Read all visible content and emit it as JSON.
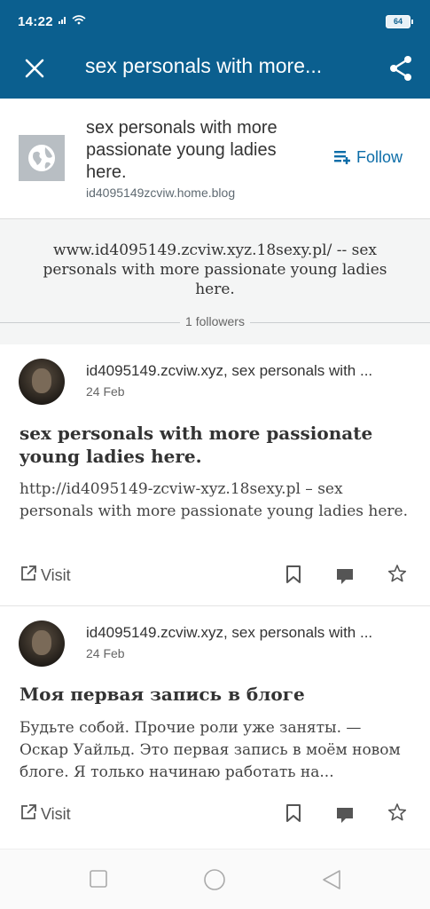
{
  "status_bar": {
    "time": "14:22",
    "battery": "64"
  },
  "app_bar": {
    "title": "sex personals with more..."
  },
  "blog": {
    "title": "sex personals with more passionate young ladies here.",
    "url": "id4095149zcviw.home.blog",
    "follow_label": "Follow",
    "description": "www.id4095149.zcviw.xyz.18sexy.pl/ -- sex personals with more passionate young ladies here.",
    "followers": "1 followers"
  },
  "posts": [
    {
      "site": "id4095149.zcviw.xyz, sex personals with ...",
      "date": "24 Feb",
      "title": "sex personals with more passionate young ladies here.",
      "excerpt": "http://id4095149-zcviw-xyz.18sexy.pl – sex personals with more passionate young ladies here.",
      "visit_label": "Visit"
    },
    {
      "site": "id4095149.zcviw.xyz, sex personals with ...",
      "date": "24 Feb",
      "title": "Моя первая запись в блоге",
      "excerpt": "Будьте собой. Прочие роли уже заняты. — Оскар Уайльд. Это первая запись в моём новом блоге. Я только начинаю работать на...",
      "visit_label": "Visit"
    }
  ],
  "icons": {
    "close": "close-icon",
    "share": "share-icon",
    "follow": "follow-reader-icon",
    "visit": "external-link-icon",
    "bookmark": "bookmark-icon",
    "comment": "comment-icon",
    "like": "star-icon"
  },
  "colors": {
    "brand": "#0b5f8f",
    "accent": "#0c6da8"
  }
}
